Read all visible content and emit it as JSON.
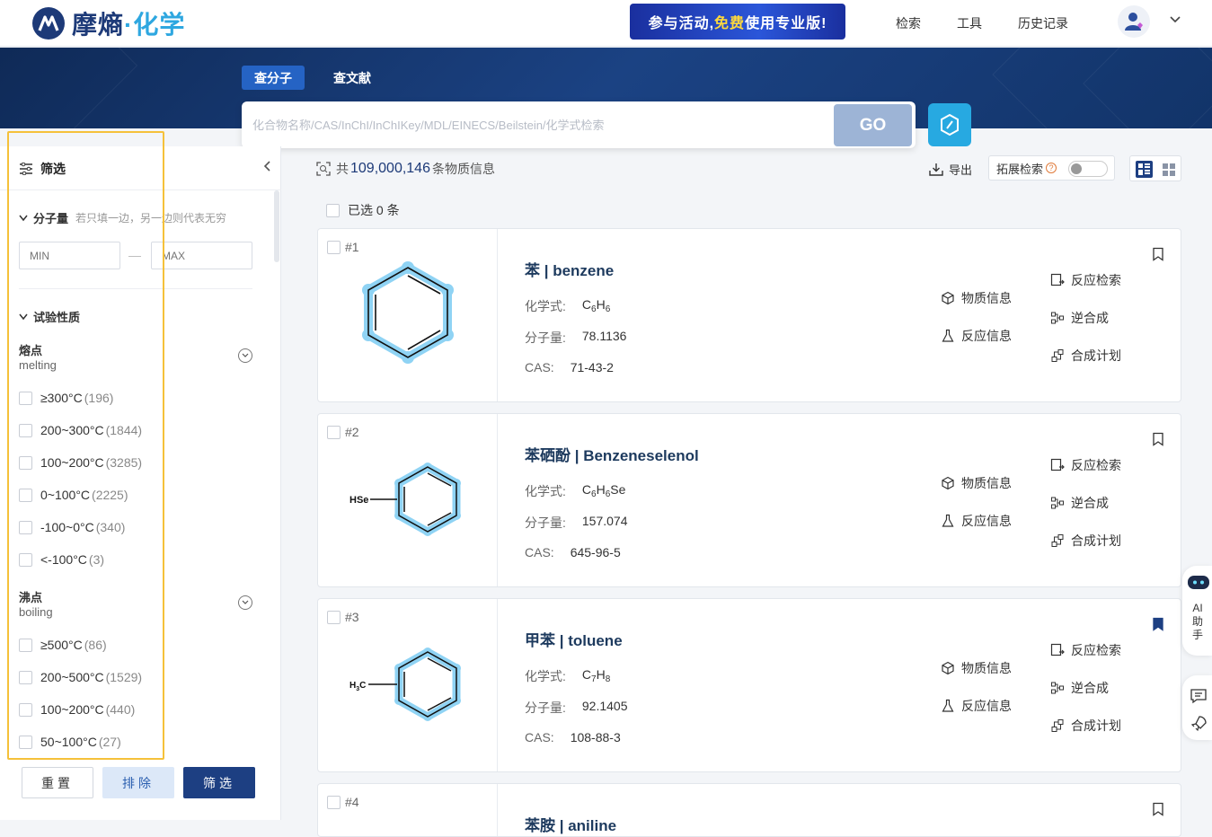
{
  "header": {
    "logo_text_main": "摩熵",
    "logo_text_accent": "·化学",
    "promo_prefix": "参与活动,",
    "promo_free": "免费",
    "promo_suffix": "使用专业版!",
    "nav": [
      "检索",
      "工具",
      "历史记录"
    ]
  },
  "search": {
    "tabs": [
      "查分子",
      "查文献"
    ],
    "placeholder": "化合物名称/CAS/InChI/InChIKey/MDL/EINECS/Beilstein/化学式检索",
    "go_label": "GO"
  },
  "sidebar": {
    "title": "筛选",
    "mw": {
      "title": "分子量",
      "hint": "若只填一边，另一边则代表无穷",
      "min_placeholder": "MIN",
      "max_placeholder": "MAX",
      "dash": "—"
    },
    "exp": {
      "title": "试验性质"
    },
    "melting": {
      "name": "熔点",
      "sub": "melting",
      "options": [
        {
          "label": "≥300°C",
          "count": "(196)"
        },
        {
          "label": "200~300°C",
          "count": "(1844)"
        },
        {
          "label": "100~200°C",
          "count": "(3285)"
        },
        {
          "label": "0~100°C",
          "count": "(2225)"
        },
        {
          "label": "-100~0°C",
          "count": "(340)"
        },
        {
          "label": "<-100°C",
          "count": "(3)"
        }
      ]
    },
    "boiling": {
      "name": "沸点",
      "sub": "boiling",
      "options": [
        {
          "label": "≥500°C",
          "count": "(86)"
        },
        {
          "label": "200~500°C",
          "count": "(1529)"
        },
        {
          "label": "100~200°C",
          "count": "(440)"
        },
        {
          "label": "50~100°C",
          "count": "(27)"
        }
      ]
    },
    "buttons": {
      "reset": "重置",
      "exclude": "排除",
      "filter": "筛选"
    }
  },
  "results": {
    "summary_prefix": "共",
    "total": "109,000,146",
    "summary_suffix": "条物质信息",
    "export_label": "导出",
    "ext_label": "拓展检索",
    "ext_q": "?",
    "selected_label": "已选 0 条",
    "labels": {
      "formula": "化学式:",
      "mw": "分子量:",
      "cas": "CAS:"
    },
    "actions": {
      "info": "物质信息",
      "rxn_info": "反应信息",
      "rxn_search": "反应检索",
      "retro": "逆合成",
      "plan": "合成计划"
    },
    "items": [
      {
        "index": "#1",
        "name": "苯 | benzene",
        "formula_parts": [
          "C",
          "6",
          "H",
          "6",
          ""
        ],
        "mw": "78.1136",
        "cas": "71-43-2",
        "bookmarked": false,
        "mol_label": ""
      },
      {
        "index": "#2",
        "name": "苯硒酚 | Benzeneselenol",
        "formula_parts": [
          "C",
          "6",
          "H",
          "6",
          "Se"
        ],
        "mw": "157.074",
        "cas": "645-96-5",
        "bookmarked": false,
        "mol_label": "HSe"
      },
      {
        "index": "#3",
        "name": "甲苯 | toluene",
        "formula_parts": [
          "C",
          "7",
          "H",
          "8",
          ""
        ],
        "mw": "92.1405",
        "cas": "108-88-3",
        "bookmarked": true,
        "mol_label": "H3C"
      },
      {
        "index": "#4",
        "name": "苯胺 | aniline"
      }
    ]
  },
  "ai": {
    "label_1": "AI",
    "label_2": "助",
    "label_3": "手"
  },
  "colors": {
    "brand": "#1d3a78",
    "accent": "#2ea7e0",
    "highlight_box": "#f5c13a",
    "bookmark_active": "#1d3f82"
  }
}
